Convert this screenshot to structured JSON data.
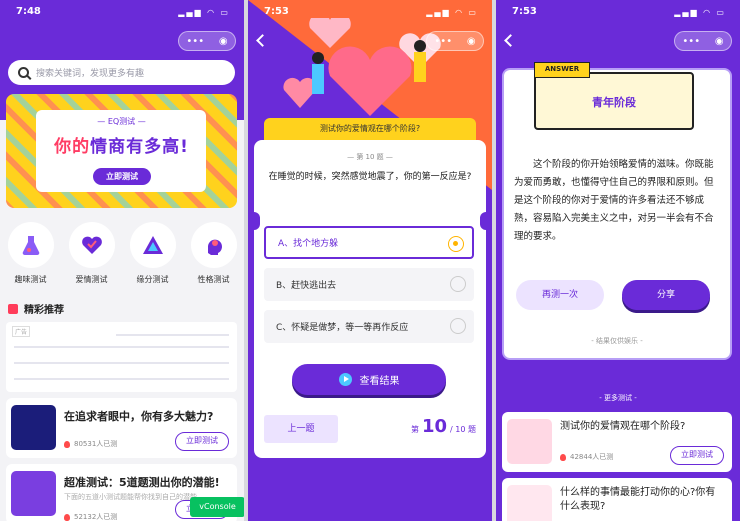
{
  "phones": [
    {
      "time": "7:48",
      "search_placeholder": "搜索关键词，发现更多有趣",
      "banner": {
        "tag": "EQ测试",
        "headline_a": "你的",
        "headline_b": "情商有多高!",
        "cta": "立即测试"
      },
      "categories": [
        "趣味测试",
        "爱情测试",
        "缘分测试",
        "性格测试"
      ],
      "section_title": "精彩推荐",
      "ad_label": "广告",
      "cards": [
        {
          "title": "在追求者眼中，你有多大魅力?",
          "subtitle": "",
          "count": "80531人已测",
          "button": "立即测试"
        },
        {
          "title": "超准测试：5道题测出你的潜能!",
          "subtitle": "下面的五道小测试题能帮你找到自己的潜能",
          "count": "52132人已测",
          "button": "立即测试"
        }
      ],
      "vconsole": "vConsole"
    },
    {
      "time": "7:53",
      "question_header": "测试你的爱情观在哪个阶段?",
      "question_no": "第 10 题",
      "question": "在睡觉的时候，突然感觉地震了，你的第一反应是?",
      "options": [
        "A、找个地方躲",
        "B、赶快逃出去",
        "C、怀疑是做梦，等一等再作反应"
      ],
      "selected": 0,
      "result_button": "查看结果",
      "prev_button": "上一题",
      "pager": {
        "prefix": "第",
        "current": "10",
        "total": "/ 10 题"
      }
    },
    {
      "time": "7:53",
      "answer_tag": "ANSWER",
      "answer_title": "青年阶段",
      "answer_text": "这个阶段的你开始领略爱情的滋味。你既能为爱而勇敢，也懂得守住自己的界限和原则。但是这个阶段的你对于爱情的许多看法还不够成熟，容易陷入完美主义之中，对另一半会有不合理的要求。",
      "again_button": "再测一次",
      "share_button": "分享",
      "entertainment_note": "- 结果仅供娱乐 -",
      "more_label": "- 更多测试 -",
      "cards": [
        {
          "title": "测试你的爱情观在哪个阶段?",
          "count": "42844人已测",
          "button": "立即测试"
        },
        {
          "title": "什么样的事情最能打动你的心?你有什么表现?",
          "count": "",
          "button": ""
        }
      ]
    }
  ],
  "colors": {
    "primary": "#6a2bd8",
    "accent": "#ffd21d",
    "orange": "#ff6a3a",
    "pink": "#ff3c64"
  },
  "status_icons": "signal wifi battery",
  "capsule_icons": [
    "more-dots-icon",
    "target-icon"
  ]
}
